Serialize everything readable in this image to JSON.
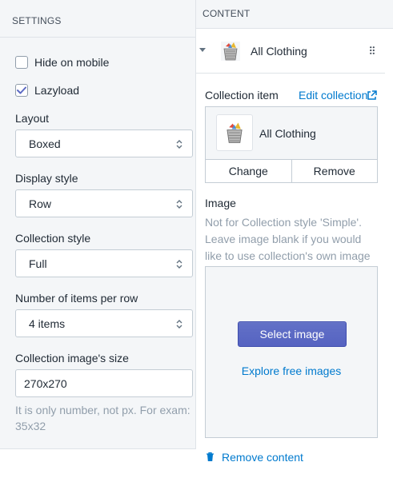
{
  "settings": {
    "header": "SETTINGS",
    "hide_on_mobile_label": "Hide on mobile",
    "lazyload_label": "Lazyload",
    "layout": {
      "label": "Layout",
      "value": "Boxed"
    },
    "display_style": {
      "label": "Display style",
      "value": "Row"
    },
    "collection_style": {
      "label": "Collection style",
      "value": "Full"
    },
    "items_per_row": {
      "label": "Number of items per row",
      "value": "4 items"
    },
    "image_size": {
      "label": "Collection image's size",
      "value": "270x270",
      "help": "It is only number, not px. For exam: 35x32"
    }
  },
  "content": {
    "header": "CONTENT",
    "item_title": "All Clothing",
    "collection_item_label": "Collection item",
    "edit_collection": "Edit collection",
    "selected_collection": "All Clothing",
    "change_label": "Change",
    "remove_label": "Remove",
    "image_label": "Image",
    "image_help": "Not for Collection style 'Simple'. Leave image blank if you would like to use collection's own image instead.",
    "select_image": "Select image",
    "explore_images": "Explore free images",
    "remove_content": "Remove content"
  },
  "colors": {
    "accent": "#5c6ac4",
    "link": "#007ace",
    "panel_bg": "#f4f6f8"
  }
}
